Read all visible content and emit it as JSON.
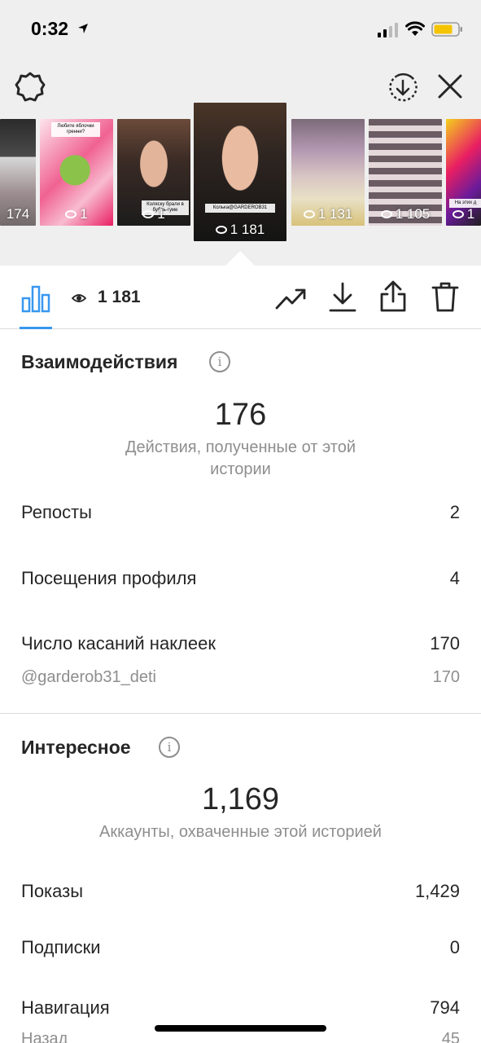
{
  "status_bar": {
    "time": "0:32"
  },
  "thumbnails": [
    {
      "views": "174"
    },
    {
      "views": "1",
      "caption": "Любите яблочки гренни?"
    },
    {
      "views": "1",
      "caption": "Коляску брали в бубль-гуме"
    },
    {
      "views": "1 181",
      "caption": "Колька@GARDEROB31"
    },
    {
      "views": "1 131"
    },
    {
      "views": "1 105"
    },
    {
      "views": "1",
      "caption": "На этих д"
    }
  ],
  "action_bar": {
    "view_count": "1 181"
  },
  "interactions": {
    "title": "Взаимодействия",
    "info": "i",
    "total": "176",
    "caption": "Действия, полученные от этой истории",
    "rows": [
      {
        "label": "Репосты",
        "value": "2"
      },
      {
        "label": "Посещения профиля",
        "value": "4"
      },
      {
        "label": "Число касаний наклеек",
        "value": "170"
      }
    ],
    "sticker": {
      "label": "@garderob31_deti",
      "value": "170"
    }
  },
  "discovery": {
    "title": "Интересное",
    "info": "i",
    "total": "1,169",
    "caption": "Аккаунты, охваченные этой историей",
    "rows": [
      {
        "label": "Показы",
        "value": "1,429"
      },
      {
        "label": "Подписки",
        "value": "0"
      },
      {
        "label": "Навигация",
        "value": "794"
      },
      {
        "label": "Назад",
        "value": "45"
      }
    ]
  },
  "colors": {
    "accent": "#3897f0",
    "muted": "#8e8e8e",
    "text": "#262626",
    "top_background": "#efefef"
  }
}
